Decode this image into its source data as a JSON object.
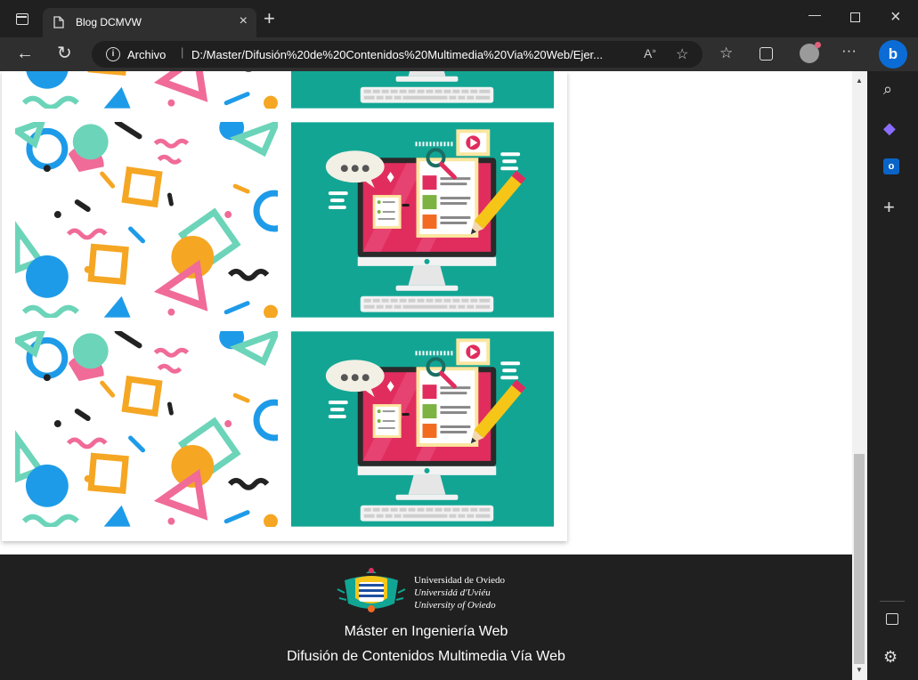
{
  "browser": {
    "tab_title": "Blog DCMVW",
    "address_scheme": "Archivo",
    "address_url": "D:/Master/Difusi%C3%B3n%20de%20Contenidos%20Multimedia%20Via%20Web/Ejer...",
    "address_url_display": "D:/Master/Difusión%20de%20Contenidos%20Multimedia%20Via%20Web/Ejer..."
  },
  "footer": {
    "university_lines": [
      "Universidad de Oviedo",
      "Universidá d'Uviéu",
      "University of Oviedo"
    ],
    "master_title": "Máster en Ingeniería Web",
    "course_title": "Difusión de Contenidos Multimedia Vía Web"
  },
  "gallery": {
    "rows": [
      {
        "left": "confetti-pattern-image",
        "right": "computer-illustration-image"
      },
      {
        "left": "confetti-pattern-image",
        "right": "computer-illustration-image"
      },
      {
        "left": "confetti-pattern-image",
        "right": "computer-illustration-image"
      }
    ]
  },
  "colors": {
    "teal": "#12a594",
    "pink": "#f06b98",
    "orange": "#f5a623",
    "blue": "#1e9be8",
    "mint": "#6cd4b9",
    "dark": "#202020"
  }
}
